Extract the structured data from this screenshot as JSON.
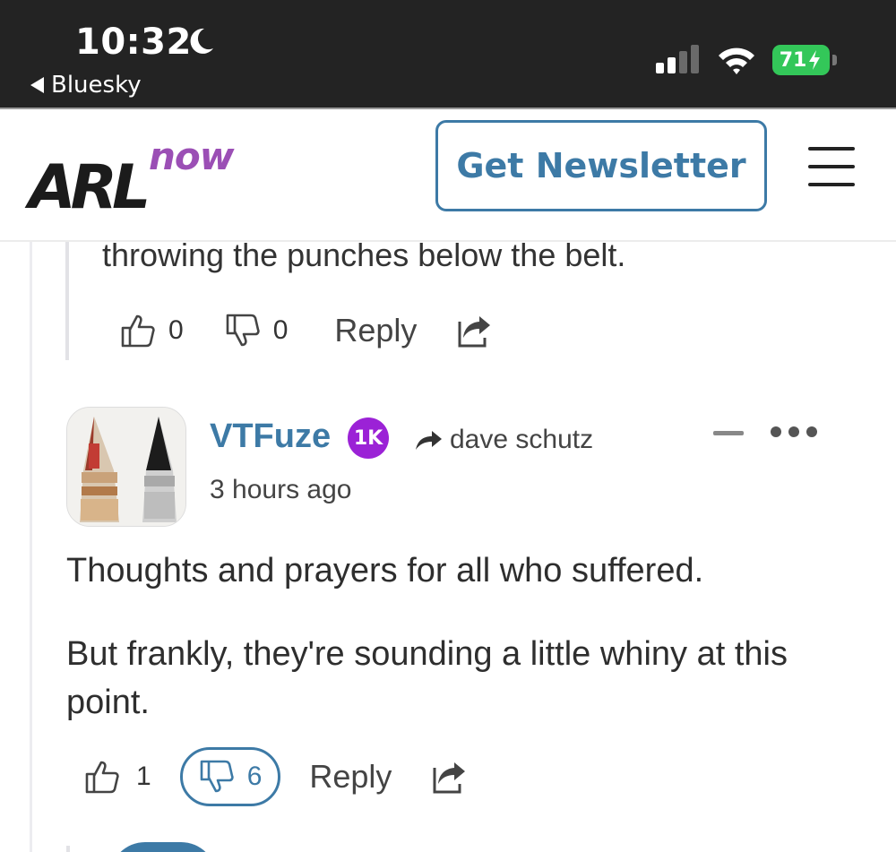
{
  "status_bar": {
    "time": "10:32",
    "back_app": "Bluesky",
    "battery": "71",
    "battery_color": "#33c759",
    "icons": [
      "moon-icon",
      "signal-icon",
      "wifi-icon",
      "battery-charging-icon"
    ]
  },
  "header": {
    "logo_main": "ARL",
    "logo_sub": "now",
    "logo_colors": {
      "main": "#1b1b1b",
      "sub": "#9b4fb5"
    },
    "newsletter_label": "Get Newsletter",
    "accent": "#3d7aa6",
    "menu_icon": "hamburger-icon"
  },
  "comments": [
    {
      "text_tail": "throwing the punches below the belt.",
      "likes": "0",
      "dislikes": "0",
      "reply_label": "Reply"
    },
    {
      "author": "VTFuze",
      "badge": "1K",
      "badge_color": "#9b22d6",
      "reply_to": "dave schutz",
      "time": "3 hours ago",
      "paragraphs": [
        "Thoughts and prayers for all who suffered.",
        "But frankly, they're sounding a little whiny at this point."
      ],
      "likes": "1",
      "dislikes": "6",
      "reply_label": "Reply"
    }
  ]
}
